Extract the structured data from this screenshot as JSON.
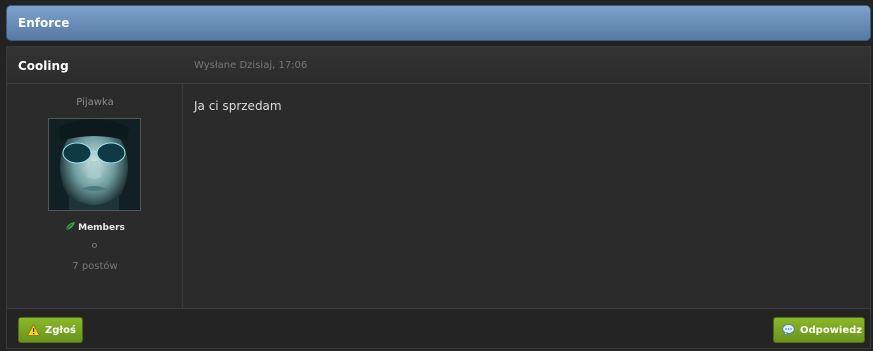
{
  "topic": {
    "title": "Enforce"
  },
  "post": {
    "author": "Cooling",
    "date": "Wysłane Dzisiaj, 17:06",
    "user_title": "Pijawka",
    "group": "Members",
    "post_count": "7 postów",
    "body": "Ja ci sprzedam",
    "avatar_icon": "avatar-image"
  },
  "buttons": {
    "report": "Zgłoś",
    "reply": "Odpowiedz"
  },
  "colors": {
    "header_blue": "#6a8fb8",
    "button_green": "#7aa622",
    "background": "#2b2b2b"
  }
}
